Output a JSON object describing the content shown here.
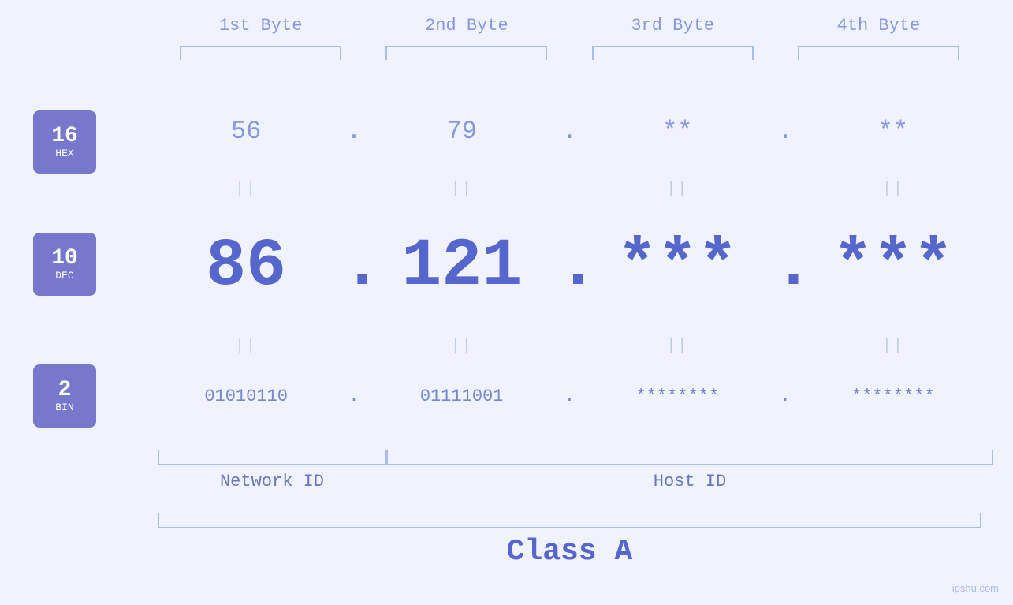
{
  "header": {
    "byte1": "1st Byte",
    "byte2": "2nd Byte",
    "byte3": "3rd Byte",
    "byte4": "4th Byte"
  },
  "badges": {
    "hex": {
      "number": "16",
      "label": "HEX"
    },
    "dec": {
      "number": "10",
      "label": "DEC"
    },
    "bin": {
      "number": "2",
      "label": "BIN"
    }
  },
  "hex_row": {
    "b1": "56",
    "dot1": ".",
    "b2": "79",
    "dot2": ".",
    "b3": "**",
    "dot3": ".",
    "b4": "**"
  },
  "dec_row": {
    "b1": "86",
    "dot1": ".",
    "b2": "121",
    "dot2": ".",
    "b3": "***",
    "dot3": ".",
    "b4": "***"
  },
  "bin_row": {
    "b1": "01010110",
    "dot1": ".",
    "b2": "01111001",
    "dot2": ".",
    "b3": "********",
    "dot3": ".",
    "b4": "********"
  },
  "equals": "||",
  "labels": {
    "network_id": "Network ID",
    "host_id": "Host ID",
    "class": "Class A"
  },
  "watermark": "ipshu.com"
}
